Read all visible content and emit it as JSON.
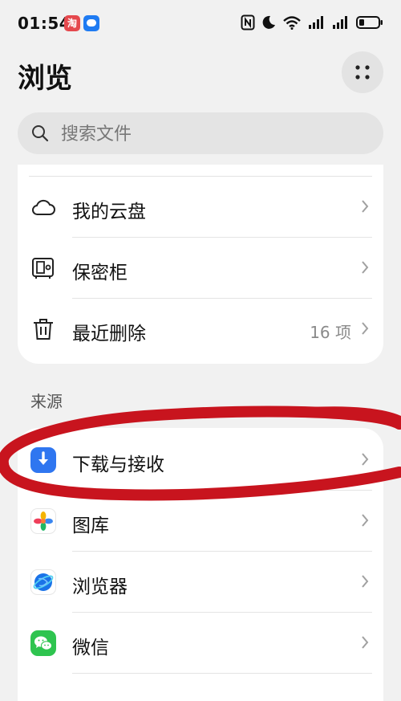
{
  "status": {
    "time": "01:54",
    "taobao_glyph": "淘"
  },
  "header": {
    "title": "浏览"
  },
  "search": {
    "placeholder": "搜索文件"
  },
  "locations": [
    {
      "label": "我的云盘"
    },
    {
      "label": "保密柜"
    },
    {
      "label": "最近删除",
      "count": "16 项"
    }
  ],
  "sources": {
    "heading": "来源",
    "items": [
      {
        "label": "下载与接收",
        "icon": "download-icon"
      },
      {
        "label": "图库",
        "icon": "gallery-icon"
      },
      {
        "label": "浏览器",
        "icon": "browser-icon"
      },
      {
        "label": "微信",
        "icon": "wechat-icon"
      }
    ]
  },
  "annotation": {
    "color": "#c8141e"
  }
}
